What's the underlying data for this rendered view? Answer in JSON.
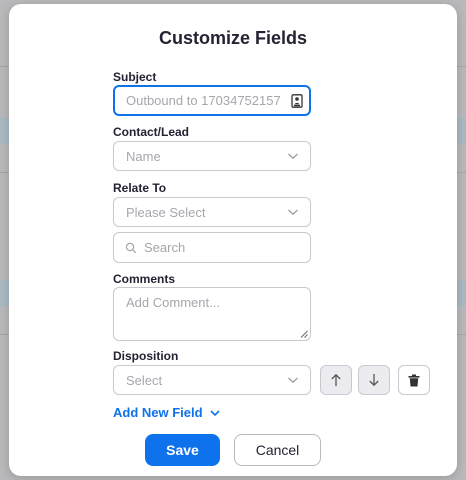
{
  "modal": {
    "title": "Customize Fields"
  },
  "fields": {
    "subject": {
      "label": "Subject",
      "placeholder": "Outbound to 17034752157",
      "icon": "contact-card-icon"
    },
    "contact_lead": {
      "label": "Contact/Lead",
      "placeholder": "Name"
    },
    "relate_to": {
      "label": "Relate To",
      "placeholder": "Please Select",
      "search_placeholder": "Search"
    },
    "comments": {
      "label": "Comments",
      "placeholder": "Add Comment..."
    },
    "disposition": {
      "label": "Disposition",
      "placeholder": "Select"
    }
  },
  "actions": {
    "add_new_field": "Add New Field",
    "save": "Save",
    "cancel": "Cancel"
  },
  "colors": {
    "accent": "#0e72ed",
    "text": "#232333",
    "placeholder": "#a6a6ad"
  }
}
